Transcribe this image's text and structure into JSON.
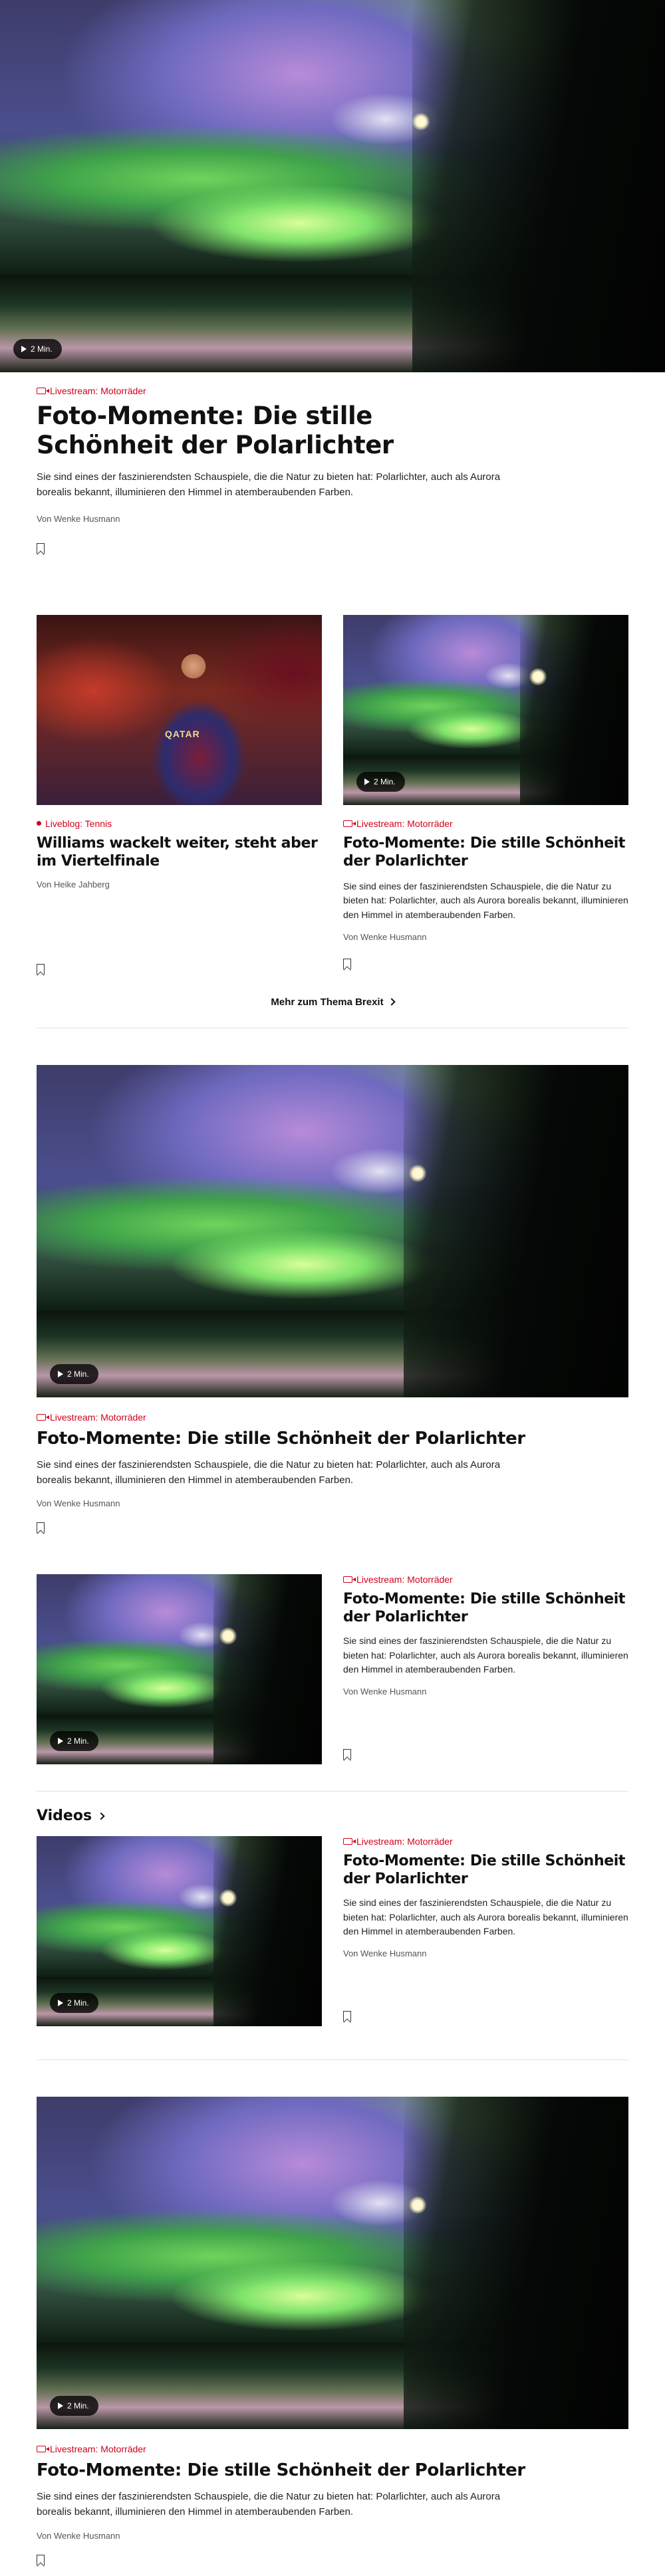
{
  "hero": {
    "video_duration": "2 Min.",
    "kicker": "Livestream: Motorräder",
    "title": "Foto-Momente: Die stille Schönheit der Polarlichter",
    "lead": "Sie sind eines der faszinierendsten Schauspiele, die die Natur zu bieten hat: Polarlichter, auch als Aurora borealis bekannt, illuminieren den Himmel in atemberaubenden Farben.",
    "author": "Von Wenke Husmann"
  },
  "pair": [
    {
      "kicker": "Liveblog: Tennis",
      "image_text": "QATAR",
      "title": "Williams wackelt weiter, steht aber im Viertelfinale",
      "author": "Von Heike Jahberg"
    },
    {
      "video_duration": "2 Min.",
      "kicker": "Livestream: Motorräder",
      "title": "Foto-Momente: Die stille Schönheit der Polarlichter",
      "lead": "Sie sind eines der faszinierendsten Schauspiele, die die Natur zu bieten hat: Polarlichter, auch als Aurora borealis bekannt, illuminieren den Himmel in atemberaubenden Farben.",
      "author": "Von Wenke Husmann"
    }
  ],
  "more_link": "Mehr zum Thema Brexit",
  "big1": {
    "video_duration": "2 Min.",
    "kicker": "Livestream: Motorräder",
    "title": "Foto-Momente: Die stille Schönheit der Polarlichter",
    "lead": "Sie sind eines der faszinierendsten Schauspiele, die die Natur zu bieten hat: Polarlichter, auch als Aurora borealis bekannt, illuminieren den Himmel in atemberaubenden Farben.",
    "author": "Von Wenke Husmann"
  },
  "row1": {
    "video_duration": "2 Min.",
    "kicker": "Livestream: Motorräder",
    "title": "Foto-Momente: Die stille Schönheit der Polarlichter",
    "lead": "Sie sind eines der faszinierendsten Schauspiele, die die Natur zu bieten hat: Polarlichter, auch als Aurora borealis bekannt, illuminieren den Himmel in atemberaubenden Farben.",
    "author": "Von Wenke Husmann"
  },
  "videos_section": {
    "heading": "Videos"
  },
  "row2": {
    "video_duration": "2 Min.",
    "kicker": "Livestream: Motorräder",
    "title": "Foto-Momente: Die stille Schönheit der Polarlichter",
    "lead": "Sie sind eines der faszinierendsten Schauspiele, die die Natur zu bieten hat: Polarlichter, auch als Aurora borealis bekannt, illuminieren den Himmel in atemberaubenden Farben.",
    "author": "Von Wenke Husmann"
  },
  "big2": {
    "video_duration": "2 Min.",
    "kicker": "Livestream: Motorräder",
    "title": "Foto-Momente: Die stille Schönheit der Polarlichter",
    "lead": "Sie sind eines der faszinierendsten Schauspiele, die die Natur zu bieten hat: Polarlichter, auch als Aurora borealis bekannt, illuminieren den Himmel in atemberaubenden Farben.",
    "author": "Von Wenke Husmann"
  },
  "colors": {
    "accent": "#d0021b",
    "text": "#111111",
    "muted": "#555555",
    "divider": "#e3e3e3"
  }
}
